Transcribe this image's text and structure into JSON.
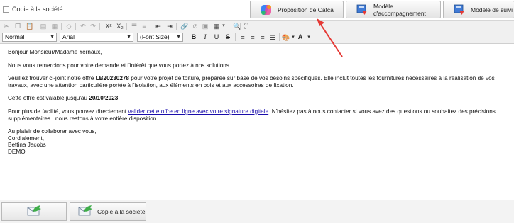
{
  "header": {
    "copy_checkbox_label": "Copie à la société",
    "buttons": [
      {
        "label": "Proposition de Cafca",
        "icon": "copilot-icon"
      },
      {
        "label": "Modèle d'accompagnement",
        "icon": "template-icon"
      },
      {
        "label": "Modèle de suivi",
        "icon": "template-icon"
      }
    ]
  },
  "toolbar": {
    "style_select": "Normal",
    "font_select": "Arial",
    "size_select": "(Font Size)",
    "bold": "B",
    "italic": "I",
    "underline": "U",
    "strike": "S",
    "font_color": "A",
    "superscript": "X²",
    "subscript": "X₂"
  },
  "email": {
    "greeting": "Bonjour Monsieur/Madame Yernaux,",
    "p1": "Nous vous remercions pour votre demande et l'intérêt que vous portez à nos solutions.",
    "p2_pre": "Veuillez trouver ci-joint notre offre ",
    "p2_ref": "LB20230278",
    "p2_post": " pour votre projet de toiture, préparée sur base de vos besoins spécifiques. Elle inclut toutes les fournitures nécessaires à la réalisation de vos travaux, avec une attention particulière portée à l'isolation, aux éléments en bois et aux accessoires de fixation.",
    "p3_pre": "Cette offre est valable jusqu'au ",
    "p3_date": "20/10/2023",
    "p3_post": ".",
    "p4_pre": "Pour plus de facilité, vous pouvez directement ",
    "p4_link": "valider cette offre en ligne avec votre signature digitale",
    "p4_post": ". N'hésitez pas à nous contacter si vous avez des questions ou souhaitez des précisions supplémentaires : nous restons à votre entière disposition.",
    "closing1": "Au plaisir de collaborer avec vous,",
    "closing2": "Cordialement,",
    "signature_name": "Bettina Jacobs",
    "signature_company": "DEMO"
  },
  "footer": {
    "send_icon": "send-mail-icon",
    "copy_button_label": "Copie à la société"
  },
  "colors": {
    "annotation_arrow": "#e53935",
    "link": "#1a0dab"
  }
}
